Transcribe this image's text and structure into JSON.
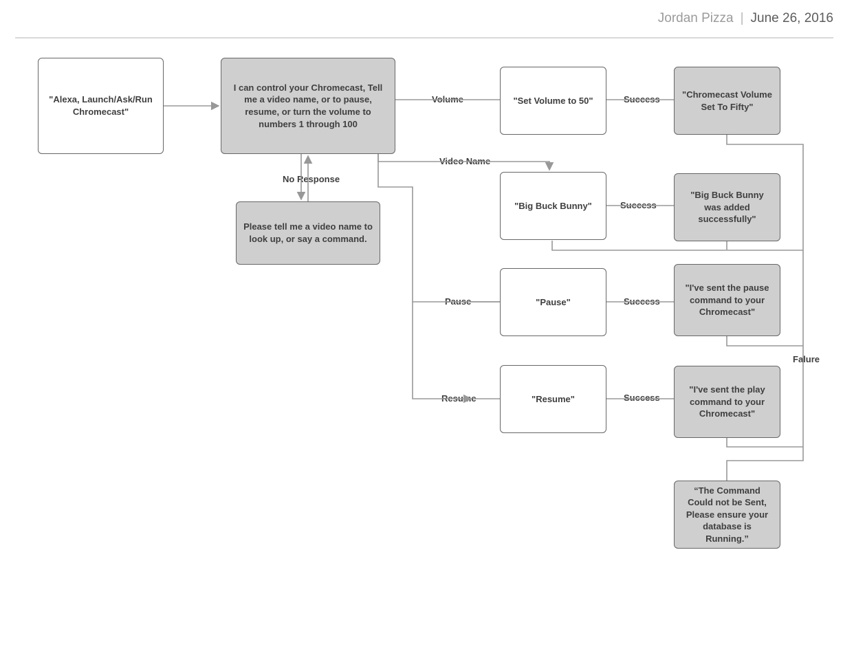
{
  "header": {
    "author": "Jordan Pizza",
    "separator": "|",
    "date": "June 26, 2016"
  },
  "boxes": {
    "launch": "\"Alexa, Launch/Ask/Run Chromecast\"",
    "intro": "I can control your Chromecast, Tell me a video name, or to pause, resume, or turn the volume to numbers 1 through 100",
    "noresp_prompt": "Please tell me a video name to look up, or say a command.",
    "setvol": "\"Set Volume to 50\"",
    "volset": "\"Chromecast Volume Set To Fifty\"",
    "bbb": "\"Big Buck Bunny\"",
    "bbb_added": "\"Big Buck Bunny was added successfully\"",
    "pause": "\"Pause\"",
    "pause_sent": "\"I've sent the pause command to your Chromecast\"",
    "resume": "\"Resume\"",
    "play_sent": "\"I've sent the play command to your Chromecast\"",
    "fail": "“The Command Could not be Sent,  Please ensure your database is Running.”"
  },
  "labels": {
    "volume": "Volume",
    "videoname": "Video Name",
    "pause": "Pause",
    "resume": "Resume",
    "noresponse": "No Response",
    "success": "Success",
    "failure": "Falure"
  }
}
